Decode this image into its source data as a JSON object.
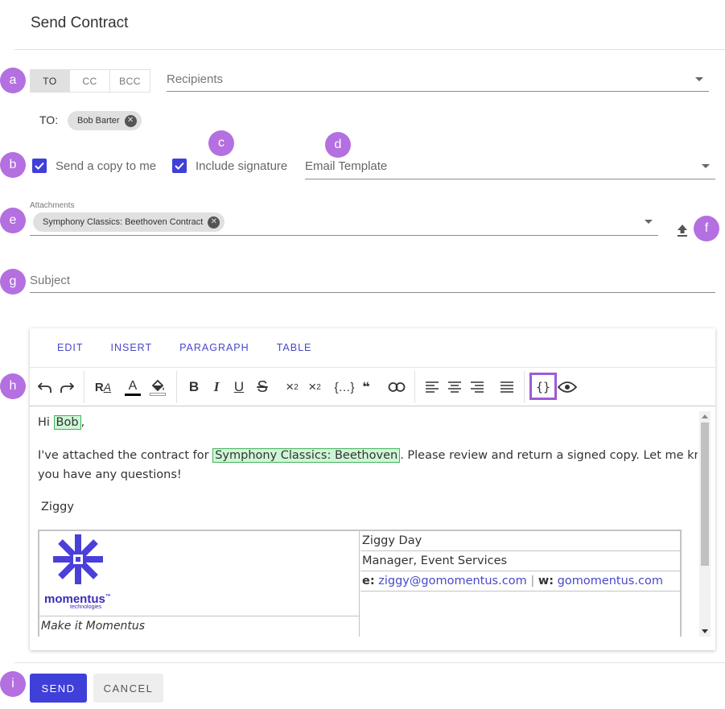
{
  "dialog": {
    "title": "Send Contract"
  },
  "annotations": {
    "a": "a",
    "b": "b",
    "c": "c",
    "d": "d",
    "e": "e",
    "f": "f",
    "g": "g",
    "h": "h",
    "i": "i"
  },
  "recipient_tabs": [
    "TO",
    "CC",
    "BCC"
  ],
  "recipients": {
    "placeholder": "Recipients",
    "to_label": "TO:",
    "chips": [
      "Bob Barter"
    ]
  },
  "options": {
    "copy_to_me": {
      "label": "Send a copy to me",
      "checked": true
    },
    "include_signature": {
      "label": "Include signature",
      "checked": true
    },
    "email_template_placeholder": "Email Template"
  },
  "attachments": {
    "label": "Attachments",
    "chips": [
      "Symphony Classics: Beethoven Contract"
    ]
  },
  "subject": {
    "placeholder": "Subject"
  },
  "editor": {
    "menu": [
      "EDIT",
      "INSERT",
      "PARAGRAPH",
      "TABLE"
    ],
    "toolbar_icons": [
      "undo-icon",
      "redo-icon",
      "clear-format-icon",
      "text-color-icon",
      "fill-color-icon",
      "bold-icon",
      "italic-icon",
      "underline-icon",
      "strikethrough-icon",
      "subscript-icon",
      "superscript-icon",
      "code-block-icon",
      "quote-icon",
      "link-icon",
      "align-left-icon",
      "align-center-icon",
      "align-right-icon",
      "justify-icon",
      "merge-field-icon",
      "preview-icon"
    ],
    "body": {
      "greeting_prefix": "Hi",
      "greeting_name": "Bob",
      "greeting_suffix": ",",
      "line1_prefix": "I've attached the contract for",
      "line1_field": "Symphony Classics: Beethoven",
      "line1_suffix": ". Please review and return a signed copy. Let me know if",
      "line2": "you have any questions!",
      "signoff": "Ziggy"
    },
    "signature": {
      "logo_text": "momentus",
      "logo_sub": "technologies",
      "logo_tm": "™",
      "tagline": "Make it Momentus",
      "name": "Ziggy Day",
      "role": "Manager, Event Services",
      "email_label": "e:",
      "email": "ziggy@gomomentus.com",
      "divider": "|",
      "web_label": "w:",
      "web": "gomomentus.com"
    }
  },
  "actions": {
    "send": "SEND",
    "cancel": "CANCEL"
  },
  "colors": {
    "accent": "#3f3fd9",
    "badge": "#b46fe0",
    "highlight": "#cdf6d6"
  }
}
